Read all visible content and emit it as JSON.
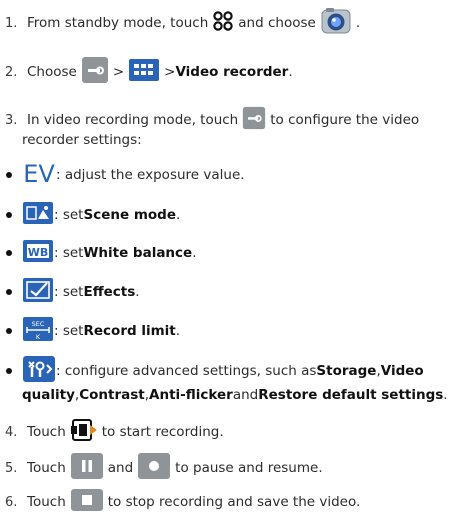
{
  "steps": [
    {
      "num": "1.",
      "a": "From standby mode, touch",
      "b": "and choose",
      "c": "."
    },
    {
      "num": "2.",
      "a": "Choose",
      "b": ">",
      "c": "> ",
      "bold": "Video recorder",
      "d": "."
    },
    {
      "num": "3.",
      "a": "In video recording mode, touch",
      "b": "to configure the video",
      "l2": "recorder settings:"
    },
    {
      "num": "4.",
      "a": "Touch",
      "b": "to start recording."
    },
    {
      "num": "5.",
      "a": "Touch",
      "b": "and",
      "c": "to pause and resume."
    },
    {
      "num": "6.",
      "a": "Touch",
      "b": "to stop recording and save the video."
    }
  ],
  "bullets": {
    "ev": {
      "icon_text": "EV",
      "text": ": adjust the exposure value."
    },
    "scene": {
      "pre": ": set ",
      "bold": "Scene mode",
      "post": "."
    },
    "wb": {
      "icon_text": "WB",
      "pre": ": set ",
      "bold": "White balance",
      "post": "."
    },
    "effects": {
      "pre": ": set ",
      "bold": "Effects",
      "post": "."
    },
    "limit": {
      "icon_text_top": "SEC",
      "icon_text_bottom": "K",
      "pre": ": set ",
      "bold": "Record limit",
      "post": "."
    },
    "adv": {
      "l1_pre": ": configure advanced settings, such as ",
      "storage": "Storage",
      "l1_mid": ", ",
      "video": "Video",
      "quality": "quality",
      "l2_mid1": ", ",
      "contrast": "Contrast",
      "l2_mid2": ", ",
      "antiflicker": "Anti-flicker",
      "l2_mid3": " and ",
      "restore": "Restore default settings",
      "l2_post": "."
    }
  },
  "icon_names": [
    "apps-grid-icon",
    "camera-icon",
    "settings-wrench-icon",
    "grid-icon",
    "ev-icon",
    "scene-mode-icon",
    "white-balance-icon",
    "effects-icon",
    "record-limit-icon",
    "advanced-settings-icon",
    "record-button-icon",
    "pause-button-icon",
    "resume-button-icon",
    "stop-button-icon"
  ],
  "colors": {
    "icon_blue": "#2a64b8",
    "icon_gray": "#8f9499",
    "text": "#2b2b2b"
  }
}
